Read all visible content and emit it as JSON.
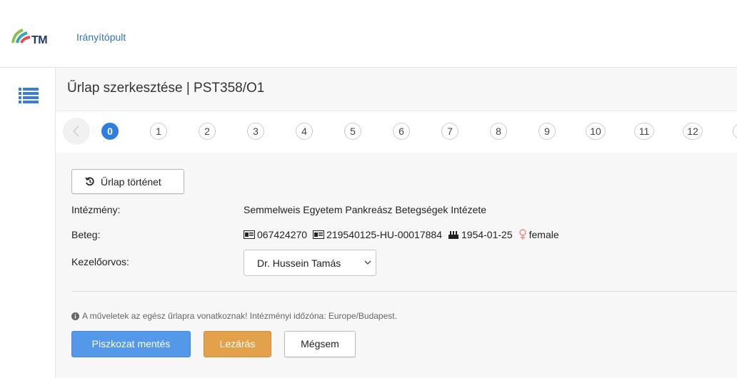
{
  "header": {
    "logo_text": "TM",
    "nav_link": "Irányítópult"
  },
  "sidebar": {
    "menu_icon": "list-icon"
  },
  "main": {
    "title": "Űrlap szerkesztése | PST358/O1",
    "stepper": {
      "active": "0",
      "steps": [
        "0",
        "1",
        "2",
        "3",
        "4",
        "5",
        "6",
        "7",
        "8",
        "9",
        "10",
        "11",
        "12"
      ]
    },
    "history_button": "Űrlap történet",
    "fields": {
      "institution_label": "Intézmény:",
      "institution_value": "Semmelweis Egyetem Pankreász Betegségek Intézete",
      "patient_label": "Beteg:",
      "patient_id": "067424270",
      "patient_code": "219540125-HU-00017884",
      "patient_birth": "1954-01-25",
      "patient_gender": "female",
      "doctor_label": "Kezelőorvos:",
      "doctor_value": "Dr. Hussein Tamás"
    },
    "info_text": "A műveletek az egész űrlapra vonatkoznak! Intézményi időzóna: Europe/Budapest.",
    "buttons": {
      "draft_save": "Piszkozat mentés",
      "close": "Lezárás",
      "cancel": "Mégsem"
    }
  },
  "colors": {
    "accent_blue": "#2f7de1",
    "link_blue": "#2f73c1",
    "draft_button": "#5498ea",
    "close_button": "#e2a14a",
    "female_icon": "#f08a8a"
  }
}
